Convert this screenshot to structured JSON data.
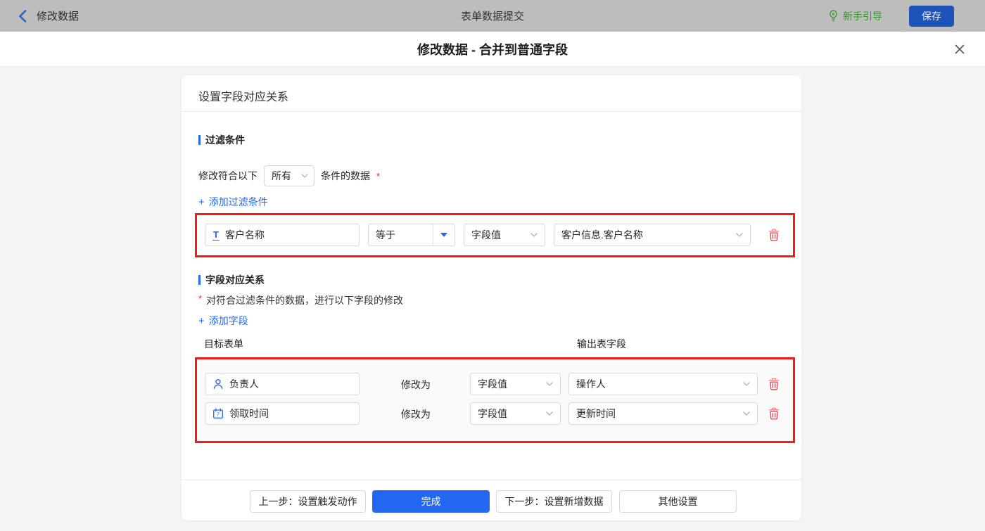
{
  "colors": {
    "accent_blue": "#2468f2",
    "topbar_bg": "#bdbdbd",
    "save_button_bg": "#1e53b8",
    "guide_green": "#2f9e27",
    "highlight_red": "#f11b1b",
    "trash_red": "#f5454f",
    "required_red": "#f5222d"
  },
  "icons": {
    "back": "chevron-left",
    "guide": "lightbulb",
    "close": "x",
    "plus": "+",
    "field_text": "T",
    "select_caret": "chevron-down",
    "operator_caret": "triangle-down",
    "row1_field": "user",
    "row2_field": "calendar",
    "delete": "trash"
  },
  "topbar": {
    "back_label": "修改数据",
    "center_title": "表单数据提交",
    "guide_label": "新手引导",
    "save_label": "保存"
  },
  "modal": {
    "title": "修改数据 - 合并到普通字段"
  },
  "card": {
    "header": "设置字段对应关系",
    "filter_section": {
      "title": "过滤条件",
      "match_prefix": "修改符合以下",
      "match_select_value": "所有",
      "match_suffix": "条件的数据",
      "required_mark": "*",
      "add_label": "添加过滤条件",
      "condition": {
        "field": "客户名称",
        "operator": "等于",
        "value_type": "字段值",
        "value": "客户信息.客户名称"
      }
    },
    "mapping_section": {
      "title": "字段对应关系",
      "required_mark": "*",
      "hint": "对符合过滤条件的数据，进行以下字段的修改",
      "add_label": "添加字段",
      "col_target": "目标表单",
      "col_output": "输出表字段",
      "rows": [
        {
          "field": "负责人",
          "action": "修改为",
          "value_type": "字段值",
          "value": "操作人"
        },
        {
          "field": "领取时间",
          "action": "修改为",
          "value_type": "字段值",
          "value": "更新时间"
        }
      ]
    },
    "footer": {
      "prev_label": "上一步：设置触发动作",
      "done_label": "完成",
      "next_label": "下一步：设置新增数据",
      "other_label": "其他设置"
    }
  }
}
